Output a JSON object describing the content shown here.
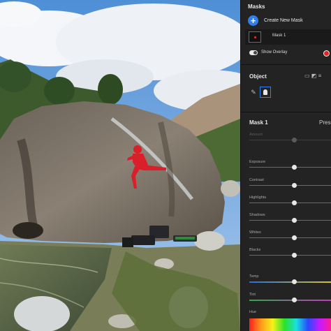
{
  "panel": {
    "masks_title": "Masks",
    "create_new_mask": "Create New Mask",
    "mask_item": "Mask 1",
    "show_overlay": "Show Overlay",
    "overlay_color": "#e0242a",
    "object_title": "Object",
    "object_side_icons": "▭ ◩ ≡",
    "mask_settings_title": "Mask 1",
    "preset_label": "Prese",
    "sliders": [
      {
        "label": "Amount",
        "value": 0.55,
        "dim": true
      },
      {
        "label": "Exposure",
        "value": 0.55
      },
      {
        "label": "Contrast",
        "value": 0.55
      },
      {
        "label": "Highlights",
        "value": 0.55
      },
      {
        "label": "Shadows",
        "value": 0.55
      },
      {
        "label": "Whites",
        "value": 0.55
      },
      {
        "label": "Blacks",
        "value": 0.55
      },
      {
        "label": "Temp",
        "value": 0.55,
        "kind": "temp"
      },
      {
        "label": "Tint",
        "value": 0.55,
        "kind": "tint"
      }
    ],
    "hue_label": "Hue"
  },
  "colors": {
    "accent": "#2f80ed",
    "panel_bg": "#232323",
    "mask_overlay": "#d81f2a"
  }
}
